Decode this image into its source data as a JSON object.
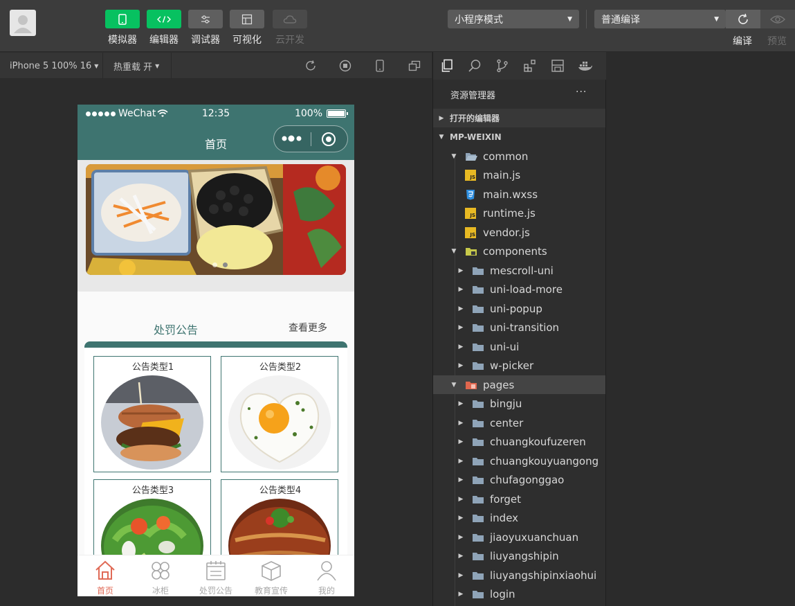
{
  "toolbar": {
    "tools": [
      {
        "label": "模拟器",
        "style": "green"
      },
      {
        "label": "编辑器",
        "style": "green"
      },
      {
        "label": "调试器",
        "style": "gray"
      },
      {
        "label": "可视化",
        "style": "gray"
      },
      {
        "label": "云开发",
        "style": "disabled"
      }
    ],
    "mode_select": "小程序模式",
    "compile_select": "普通编译",
    "compile_label": "编译",
    "preview_label": "预览"
  },
  "simbar": {
    "device": "iPhone 5 100% 16",
    "hot_reload": "热重载 开"
  },
  "phone": {
    "status": {
      "carrier": "WeChat",
      "time": "12:35",
      "battery": "100%"
    },
    "nav_title": "首页",
    "section_title": "处罚公告",
    "section_more": "查看更多",
    "cards": [
      "公告类型1",
      "公告类型2",
      "公告类型3",
      "公告类型4"
    ],
    "tabs": [
      "首页",
      "冰柜",
      "处罚公告",
      "教育宣传",
      "我的"
    ]
  },
  "explorer": {
    "title": "资源管理器",
    "menu": "···",
    "open_editors": "打开的编辑器",
    "root": "MP-WEIXIN",
    "tree": [
      {
        "name": "common",
        "type": "folder-open",
        "depth": 1
      },
      {
        "name": "main.js",
        "type": "js",
        "depth": 2
      },
      {
        "name": "main.wxss",
        "type": "css",
        "depth": 2
      },
      {
        "name": "runtime.js",
        "type": "js",
        "depth": 2
      },
      {
        "name": "vendor.js",
        "type": "js",
        "depth": 2
      },
      {
        "name": "components",
        "type": "folder-components",
        "depth": 1
      },
      {
        "name": "mescroll-uni",
        "type": "folder",
        "depth": 2
      },
      {
        "name": "uni-load-more",
        "type": "folder",
        "depth": 2
      },
      {
        "name": "uni-popup",
        "type": "folder",
        "depth": 2
      },
      {
        "name": "uni-transition",
        "type": "folder",
        "depth": 2
      },
      {
        "name": "uni-ui",
        "type": "folder",
        "depth": 2
      },
      {
        "name": "w-picker",
        "type": "folder",
        "depth": 2
      },
      {
        "name": "pages",
        "type": "folder-pages",
        "depth": 1
      },
      {
        "name": "bingju",
        "type": "folder",
        "depth": 2
      },
      {
        "name": "center",
        "type": "folder",
        "depth": 2
      },
      {
        "name": "chuangkoufuzeren",
        "type": "folder",
        "depth": 2
      },
      {
        "name": "chuangkouyuangong",
        "type": "folder",
        "depth": 2
      },
      {
        "name": "chufagonggao",
        "type": "folder",
        "depth": 2
      },
      {
        "name": "forget",
        "type": "folder",
        "depth": 2
      },
      {
        "name": "index",
        "type": "folder",
        "depth": 2
      },
      {
        "name": "jiaoyuxuanchuan",
        "type": "folder",
        "depth": 2
      },
      {
        "name": "liuyangshipin",
        "type": "folder",
        "depth": 2
      },
      {
        "name": "liuyangshipinxiaohui",
        "type": "folder",
        "depth": 2
      },
      {
        "name": "login",
        "type": "folder",
        "depth": 2
      }
    ]
  },
  "colors": {
    "accent_green": "#07c160",
    "theme_teal": "#3e7470",
    "tab_active": "#e06a56"
  }
}
